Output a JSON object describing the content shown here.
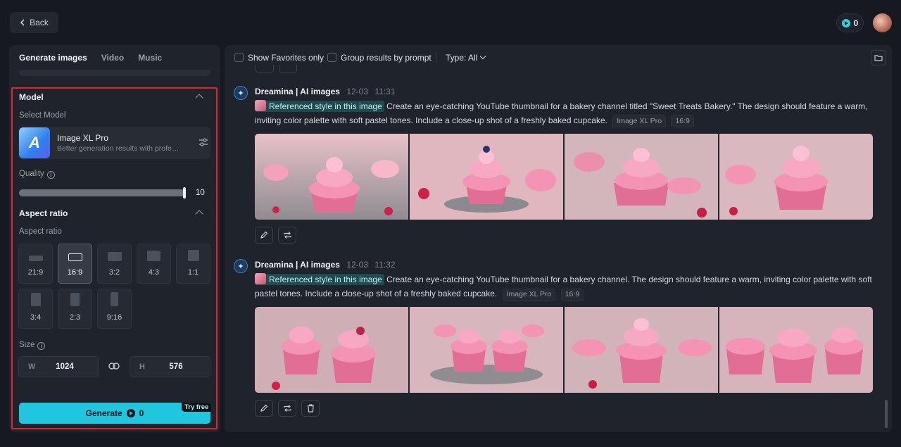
{
  "topbar": {
    "back_label": "Back",
    "credits": "0"
  },
  "left": {
    "tabs": [
      "Generate images",
      "Video",
      "Music"
    ],
    "model_section_title": "Model",
    "select_model_label": "Select Model",
    "model": {
      "logo_letter": "A",
      "name": "Image XL Pro",
      "description": "Better generation results with professional-level quality"
    },
    "quality_label": "Quality",
    "quality_value": "10",
    "quality_fraction": 1.0,
    "aspect_section_title": "Aspect ratio",
    "aspect_label": "Aspect ratio",
    "ratios": [
      "21:9",
      "16:9",
      "3:2",
      "4:3",
      "1:1",
      "3:4",
      "2:3",
      "9:16"
    ],
    "selected_ratio": "16:9",
    "size_label": "Size",
    "width_letter": "W",
    "width_value": "1024",
    "height_letter": "H",
    "height_value": "576",
    "generate_label": "Generate",
    "generate_cost": "0",
    "try_free": "Try free"
  },
  "right": {
    "show_favorites": "Show Favorites only",
    "group_results": "Group results by prompt",
    "type_label": "Type: All",
    "entries": [
      {
        "source": "Dreamina | AI images",
        "date": "12-03",
        "time": "11:31",
        "ref_tag": "Referenced style in this image",
        "prompt": "Create an eye-catching YouTube thumbnail for a bakery channel titled \"Sweet Treats Bakery.\" The design should feature a warm, inviting color palette with soft pastel tones. Include a close-up shot of a freshly baked cupcake.",
        "model_chip": "Image XL Pro",
        "ratio_chip": "16:9"
      },
      {
        "source": "Dreamina | AI images",
        "date": "12-03",
        "time": "11:32",
        "ref_tag": "Referenced style in this image",
        "prompt": "Create an eye-catching YouTube thumbnail for a bakery channel. The design should feature a warm, inviting color palette with soft pastel tones. Include a close-up shot of a freshly baked cupcake.",
        "model_chip": "Image XL Pro",
        "ratio_chip": "16:9"
      }
    ]
  },
  "colors": {
    "accent": "#1fc6de",
    "highlight_border": "#e0252c",
    "background": "#16191f",
    "panel": "#1f242c"
  }
}
